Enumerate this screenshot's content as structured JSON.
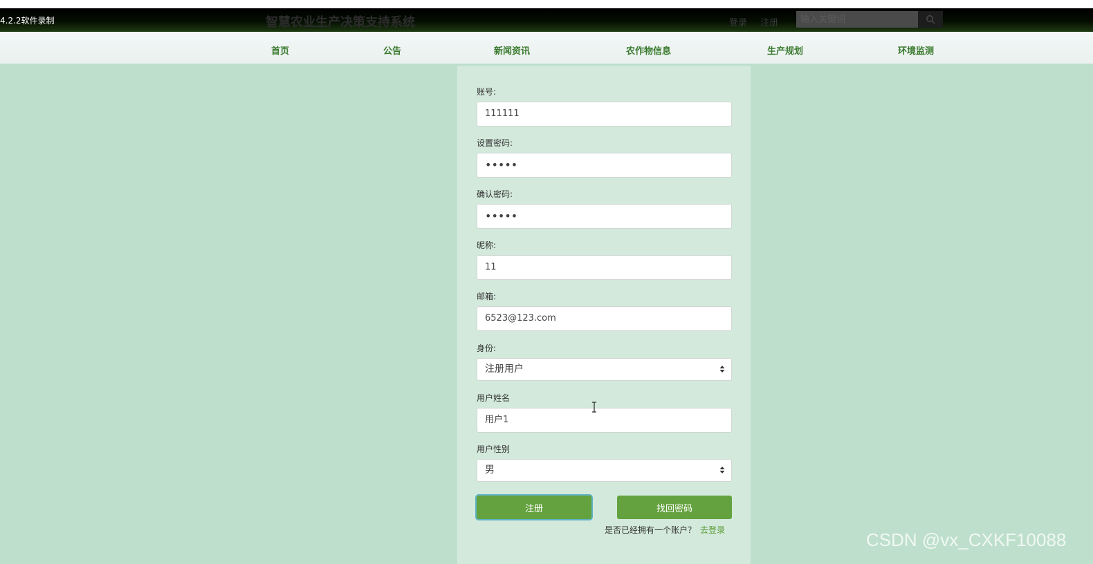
{
  "recorder_label": "4.2.2软件录制",
  "header": {
    "site_title": "智慧农业生产决策支持系统",
    "login_link": "登录",
    "register_link": "注册",
    "search_placeholder": "输入关键词",
    "search_icon": "search-icon"
  },
  "nav": {
    "items": [
      {
        "label": "首页"
      },
      {
        "label": "公告"
      },
      {
        "label": "新闻资讯"
      },
      {
        "label": "农作物信息"
      },
      {
        "label": "生产规划"
      },
      {
        "label": "环境监测"
      }
    ]
  },
  "form": {
    "account": {
      "label": "账号:",
      "value": "111111"
    },
    "password": {
      "label": "设置密码:",
      "value": "•••••"
    },
    "confirm_password": {
      "label": "确认密码:",
      "value": "•••••"
    },
    "nickname": {
      "label": "昵称:",
      "value": "11"
    },
    "email": {
      "label": "邮箱:",
      "value": "6523@123.com"
    },
    "role": {
      "label": "身份:",
      "selected": "注册用户"
    },
    "user_name": {
      "label": "用户姓名",
      "value": "用户1"
    },
    "user_gender": {
      "label": "用户性别",
      "selected": "男"
    },
    "register_button": "注册",
    "find_password_button": "找回密码",
    "login_prompt": "是否已经拥有一个账户？",
    "login_link": "去登录"
  },
  "watermark": "CSDN @vx_CXKF10088",
  "colors": {
    "page_background": "#bddfcb",
    "panel_background": "#d3e9dc",
    "accent_green": "#64a23f",
    "nav_text": "#3a7a2e"
  }
}
